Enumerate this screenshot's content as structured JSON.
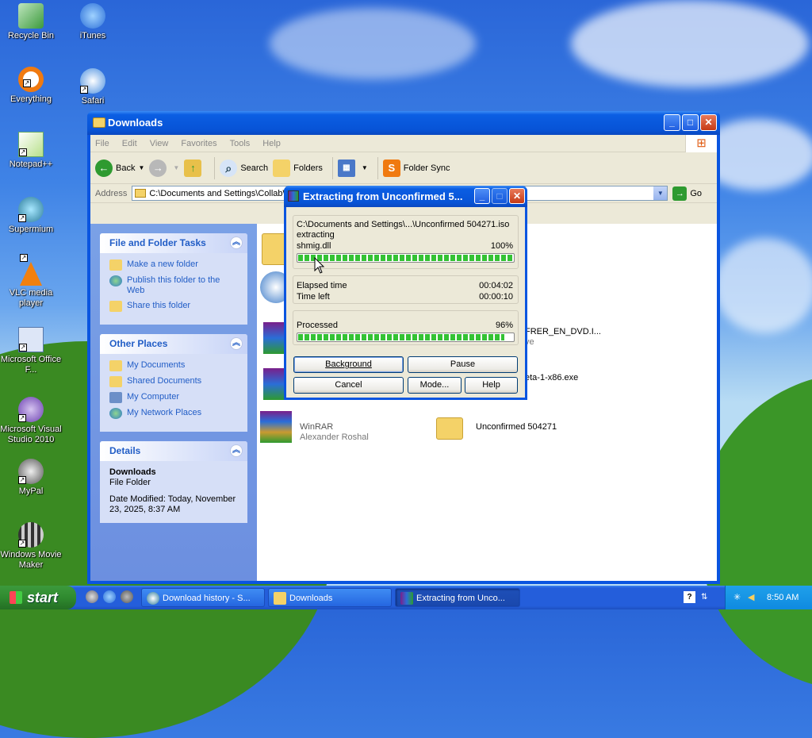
{
  "desktop": {
    "icons": [
      {
        "label": "Recycle Bin"
      },
      {
        "label": "iTunes"
      },
      {
        "label": "Everything"
      },
      {
        "label": "Safari"
      },
      {
        "label": "Notepad++"
      },
      {
        "label": "Supermium"
      },
      {
        "label": "VLC media player"
      },
      {
        "label": "Microsoft Office F..."
      },
      {
        "label": "Microsoft Visual Studio 2010"
      },
      {
        "label": "MyPal"
      },
      {
        "label": "Windows Movie Maker"
      }
    ]
  },
  "explorer": {
    "title": "Downloads",
    "menu": [
      "File",
      "Edit",
      "View",
      "Favorites",
      "Tools",
      "Help"
    ],
    "toolbar": {
      "back": "Back",
      "search": "Search",
      "folders": "Folders",
      "folder_sync": "Folder Sync"
    },
    "address": {
      "label": "Address",
      "value": "C:\\Documents and Settings\\CollabW",
      "go": "Go"
    },
    "file_tasks": {
      "title": "File and Folder Tasks",
      "items": [
        "Make a new folder",
        "Publish this folder to the Web",
        "Share this folder"
      ]
    },
    "other_places": {
      "title": "Other Places",
      "items": [
        "My Documents",
        "Shared Documents",
        "My Computer",
        "My Network Places"
      ]
    },
    "details": {
      "title": "Details",
      "name": "Downloads",
      "type": "File Folder",
      "modified": "Date Modified: Today, November 23, 2025, 8:37 AM"
    },
    "files": [
      {
        "name": "FRER_EN_DVD.I...",
        "sub": "ve"
      },
      {
        "name": "eta-1-x86.exe",
        "sub": ""
      },
      {
        "name": "WinRAR",
        "sub": "Alexander Roshal"
      },
      {
        "name": "Unconfirmed 504271",
        "sub": ""
      }
    ]
  },
  "extract_dialog": {
    "title": "Extracting from Unconfirmed 5...",
    "archive_path": "C:\\Documents and Settings\\...\\Unconfirmed 504271.iso",
    "action": "extracting",
    "current_file": "shmig.dll",
    "file_percent_label": "100%",
    "file_progress": 1.0,
    "elapsed_label": "Elapsed time",
    "elapsed_value": "00:04:02",
    "left_label": "Time left",
    "left_value": "00:00:10",
    "processed_label": "Processed",
    "processed_percent_label": "96%",
    "processed_progress": 0.96,
    "buttons": {
      "background": "Background",
      "pause": "Pause",
      "cancel": "Cancel",
      "mode": "Mode...",
      "help": "Help"
    }
  },
  "taskbar": {
    "start": "start",
    "tasks": [
      "Download history - S...",
      "Downloads",
      "Extracting from Unco..."
    ],
    "clock": "8:50 AM"
  },
  "colors": {
    "xp_blue": "#0a55e0",
    "progress_green": "#34c234",
    "task_link": "#215dc6"
  }
}
